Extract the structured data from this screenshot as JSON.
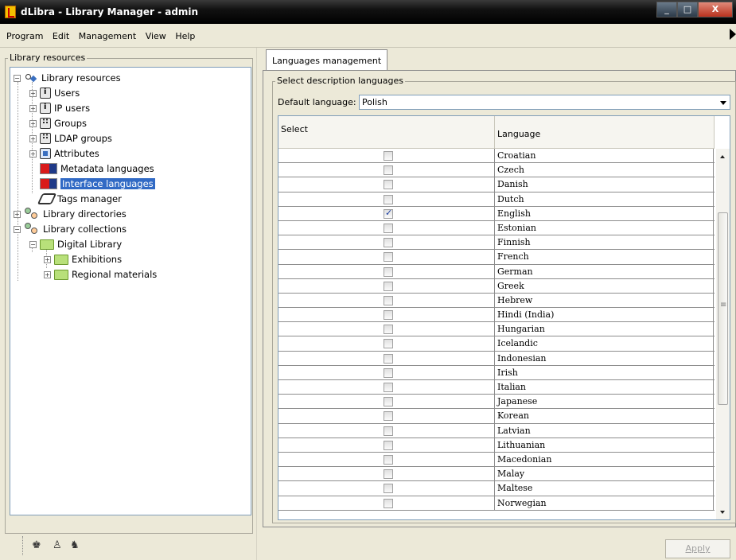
{
  "window": {
    "title": "dLibra - Library Manager - admin",
    "min": "_",
    "max": "□",
    "close": "X"
  },
  "menu": [
    "Program",
    "Edit",
    "Management",
    "View",
    "Help"
  ],
  "left": {
    "group_label": "Library resources",
    "tree": [
      {
        "label": "Library resources",
        "icon": "tree-root-icon"
      },
      {
        "label": "Users",
        "icon": "user-icon"
      },
      {
        "label": "IP users",
        "icon": "user-icon"
      },
      {
        "label": "Groups",
        "icon": "group-icon"
      },
      {
        "label": "LDAP groups",
        "icon": "group-icon"
      },
      {
        "label": "Attributes",
        "icon": "attribute-icon"
      },
      {
        "label": "Metadata languages",
        "icon": "flag-icon"
      },
      {
        "label": "Interface languages",
        "icon": "flag-icon",
        "selected": true
      },
      {
        "label": "Tags manager",
        "icon": "tag-icon"
      },
      {
        "label": "Library directories",
        "icon": "directories-icon"
      },
      {
        "label": "Library collections",
        "icon": "collections-icon"
      },
      {
        "label": "Digital Library",
        "icon": "folder-icon"
      },
      {
        "label": "Exhibitions",
        "icon": "folder-icon"
      },
      {
        "label": "Regional materials",
        "icon": "folder-icon"
      }
    ]
  },
  "right": {
    "tab_label": "Languages management",
    "group_label": "Select description languages",
    "default_language_label": "Default language:",
    "default_language_value": "Polish",
    "columns": [
      "Select",
      "Language"
    ],
    "rows": [
      {
        "language": "Croatian",
        "checked": false
      },
      {
        "language": "Czech",
        "checked": false
      },
      {
        "language": "Danish",
        "checked": false
      },
      {
        "language": "Dutch",
        "checked": false
      },
      {
        "language": "English",
        "checked": true
      },
      {
        "language": "Estonian",
        "checked": false
      },
      {
        "language": "Finnish",
        "checked": false
      },
      {
        "language": "French",
        "checked": false
      },
      {
        "language": "German",
        "checked": false
      },
      {
        "language": "Greek",
        "checked": false
      },
      {
        "language": "Hebrew",
        "checked": false
      },
      {
        "language": "Hindi (India)",
        "checked": false
      },
      {
        "language": "Hungarian",
        "checked": false
      },
      {
        "language": "Icelandic",
        "checked": false
      },
      {
        "language": "Indonesian",
        "checked": false
      },
      {
        "language": "Irish",
        "checked": false
      },
      {
        "language": "Italian",
        "checked": false
      },
      {
        "language": "Japanese",
        "checked": false
      },
      {
        "language": "Korean",
        "checked": false
      },
      {
        "language": "Latvian",
        "checked": false
      },
      {
        "language": "Lithuanian",
        "checked": false
      },
      {
        "language": "Macedonian",
        "checked": false
      },
      {
        "language": "Malay",
        "checked": false
      },
      {
        "language": "Maltese",
        "checked": false
      },
      {
        "language": "Norwegian",
        "checked": false
      }
    ],
    "apply_label": "Apply"
  }
}
